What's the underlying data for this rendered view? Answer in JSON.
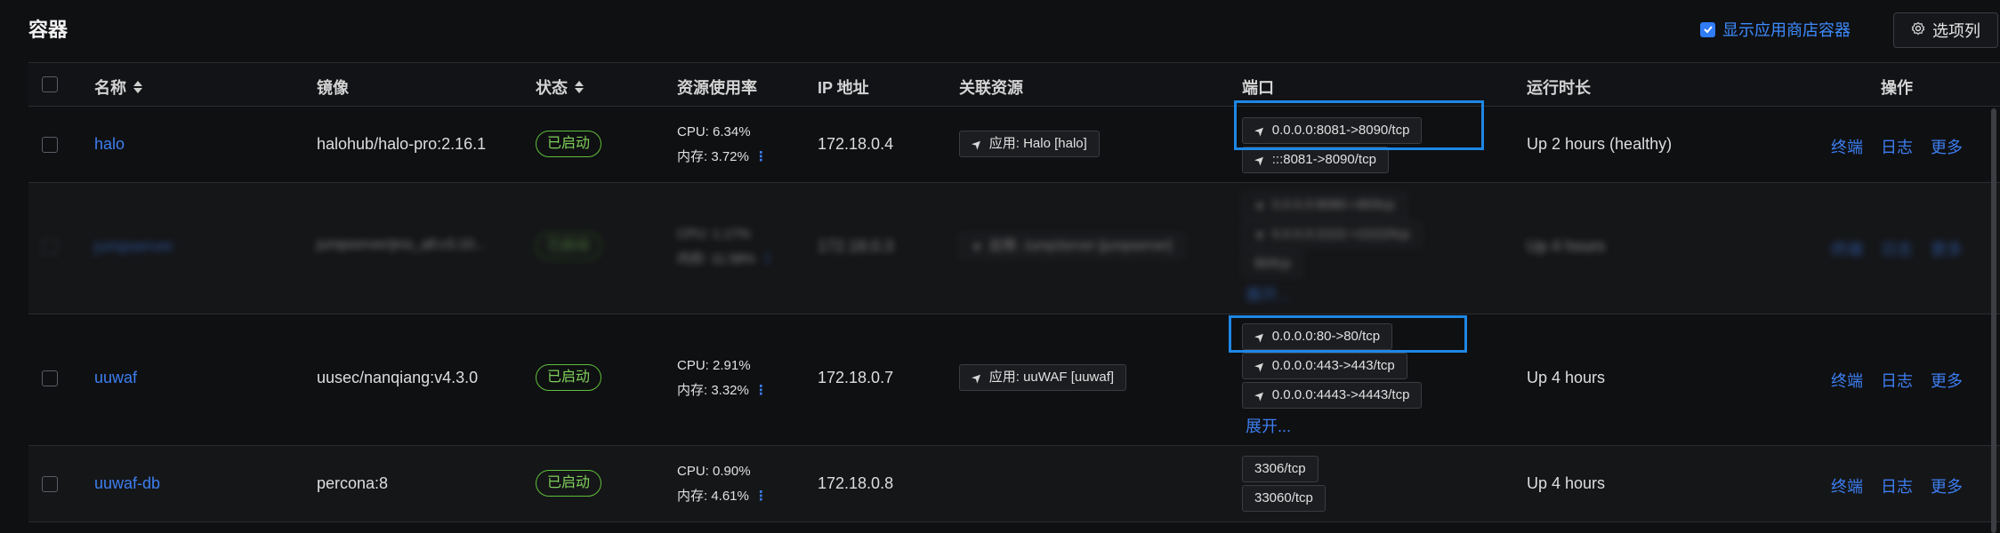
{
  "header": {
    "title": "容器",
    "app_store_label": "显示应用商店容器",
    "app_store_checked": true,
    "columns_label": "选项列"
  },
  "columns": [
    "名称",
    "镜像",
    "状态",
    "资源使用率",
    "IP 地址",
    "关联资源",
    "端口",
    "运行时长",
    "操作"
  ],
  "actions": {
    "terminal": "终端",
    "logs": "日志",
    "more": "更多"
  },
  "rows": [
    {
      "name": "halo",
      "image": "halohub/halo-pro:2.16.1",
      "status": "已启动",
      "cpu": "CPU: 6.34%",
      "mem": "内存: 3.72%",
      "ip": "172.18.0.4",
      "resource": "应用: Halo [halo]",
      "ports": [
        "0.0.0.0:8081->8090/tcp",
        ":::8081->8090/tcp"
      ],
      "uptime": "Up 2 hours (healthy)"
    },
    {
      "name": "jumpserver",
      "image": "jumpserver/jms_all:v3.10...",
      "status": "已启动",
      "cpu": "CPU: 1.17%",
      "mem": "内存: 11.58%",
      "ip": "172.18.0.3",
      "resource": "应用: JumpServer [jumpserver]",
      "ports": [
        "0.0.0.0:8080->80/tcp",
        "0.0.0.0:2222->2222/tcp",
        "80/tcp"
      ],
      "expand": "展开...",
      "uptime": "Up 4 hours"
    },
    {
      "name": "uuwaf",
      "image": "uusec/nanqiang:v4.3.0",
      "status": "已启动",
      "cpu": "CPU: 2.91%",
      "mem": "内存: 3.32%",
      "ip": "172.18.0.7",
      "resource": "应用: uuWAF [uuwaf]",
      "ports": [
        "0.0.0.0:80->80/tcp",
        "0.0.0.0:443->443/tcp",
        "0.0.0.0:4443->4443/tcp"
      ],
      "expand": "展开...",
      "uptime": "Up 4 hours"
    },
    {
      "name": "uuwaf-db",
      "image": "percona:8",
      "status": "已启动",
      "cpu": "CPU: 0.90%",
      "mem": "内存: 4.61%",
      "ip": "172.18.0.8",
      "resource": "",
      "ports": [
        "3306/tcp",
        "33060/tcp"
      ],
      "uptime": "Up 4 hours"
    }
  ],
  "colors": {
    "background": "#0f1012",
    "accent": "#3d7ef0",
    "status_green": "#7fd05a",
    "highlight_box": "#1e87e5"
  },
  "icons": {
    "settings": "gear-icon",
    "port": "send-arrow-icon",
    "resource": "send-arrow-icon",
    "sort": "sort-icon",
    "more_vertical": "vertical-dots-icon"
  }
}
